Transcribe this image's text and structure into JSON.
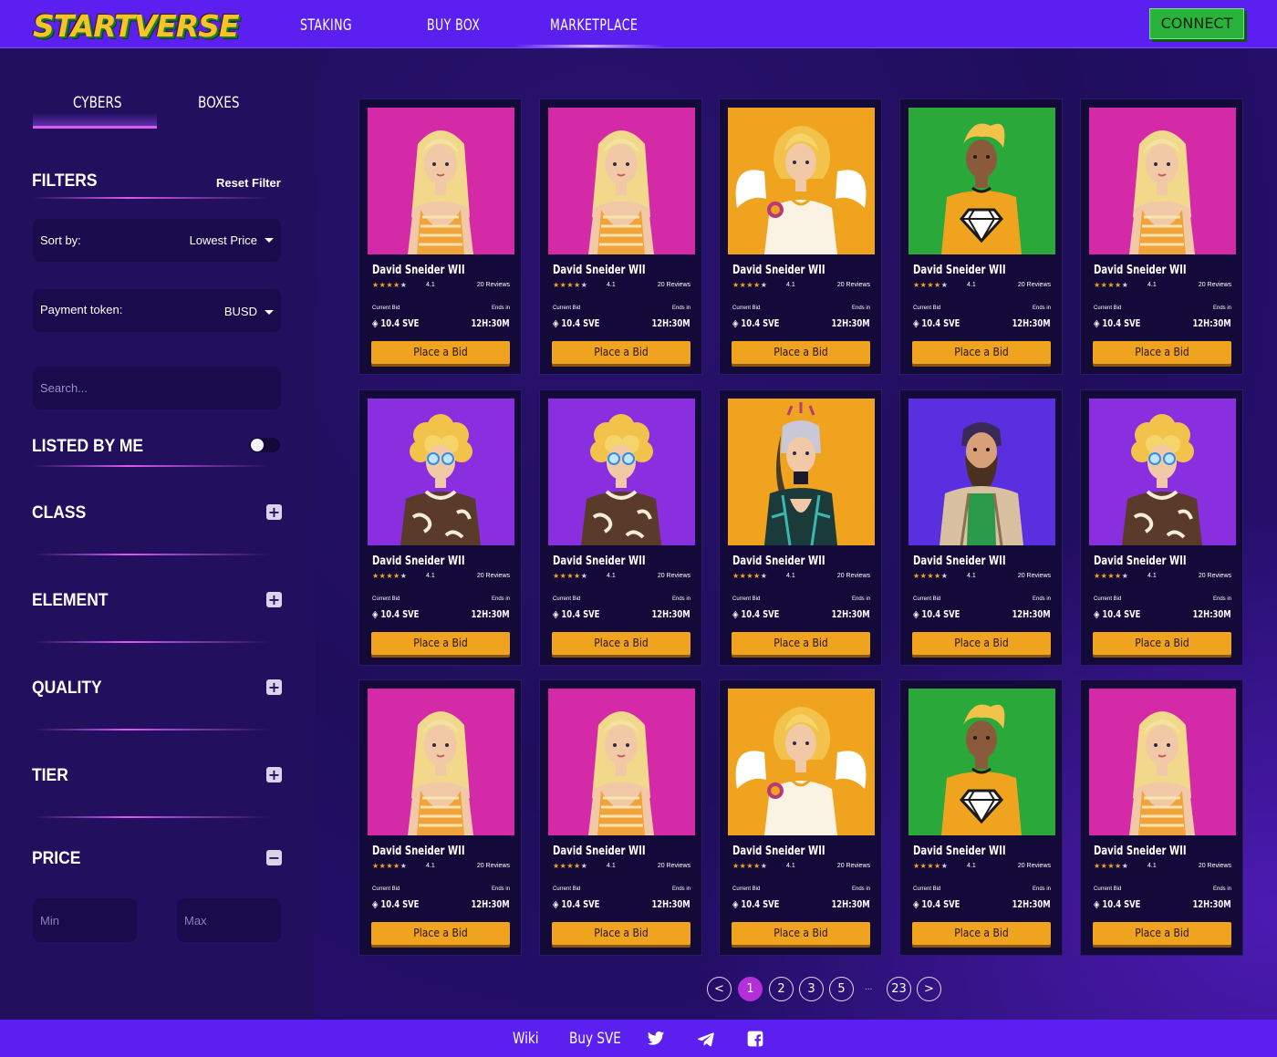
{
  "header": {
    "logo_main": "STARTVERSE",
    "nav": [
      "STAKING",
      "BUY BOX",
      "MARKETPLACE"
    ],
    "connect_label": "CONNECT"
  },
  "sidebar": {
    "tabs": [
      "CYBERS",
      "BOXES"
    ],
    "filters_title": "FILTERS",
    "reset_label": "Reset Filter",
    "sort": {
      "label": "Sort by:",
      "value": "Lowest Price"
    },
    "payment": {
      "label": "Payment token:",
      "value": "BUSD"
    },
    "search_placeholder": "Search...",
    "listed_by_me": "LISTED BY ME",
    "sections": [
      "CLASS",
      "ELEMENT",
      "QUALITY",
      "TIER",
      "PRICE"
    ],
    "price_min_placeholder": "Min",
    "price_max_placeholder": "Max"
  },
  "cards": [
    {
      "name": "David Sneider WII",
      "rating": "4.1",
      "reviews": "20 Reviews",
      "bid_label": "Current Bid",
      "price": "10.4 SVE",
      "ends_label": "Ends in",
      "time": "12H:30M",
      "button": "Place a Bid",
      "bg": "#d42aa8",
      "character": "blonde-girl"
    },
    {
      "name": "David Sneider WII",
      "rating": "4.1",
      "reviews": "20 Reviews",
      "bid_label": "Current Bid",
      "price": "10.4 SVE",
      "ends_label": "Ends in",
      "time": "12H:30M",
      "button": "Place a Bid",
      "bg": "#d42aa8",
      "character": "blonde-girl"
    },
    {
      "name": "David Sneider WII",
      "rating": "4.1",
      "reviews": "20 Reviews",
      "bid_label": "Current Bid",
      "price": "10.4 SVE",
      "ends_label": "Ends in",
      "time": "12H:30M",
      "button": "Place a Bid",
      "bg": "#f0a31f",
      "character": "angel"
    },
    {
      "name": "David Sneider WII",
      "rating": "4.1",
      "reviews": "20 Reviews",
      "bid_label": "Current Bid",
      "price": "10.4 SVE",
      "ends_label": "Ends in",
      "time": "12H:30M",
      "button": "Place a Bid",
      "bg": "#2aa83a",
      "character": "diamond-guy"
    },
    {
      "name": "David Sneider WII",
      "rating": "4.1",
      "reviews": "20 Reviews",
      "bid_label": "Current Bid",
      "price": "10.4 SVE",
      "ends_label": "Ends in",
      "time": "12H:30M",
      "button": "Place a Bid",
      "bg": "#d42aa8",
      "character": "blonde-girl"
    },
    {
      "name": "David Sneider WII",
      "rating": "4.1",
      "reviews": "20 Reviews",
      "bid_label": "Current Bid",
      "price": "10.4 SVE",
      "ends_label": "Ends in",
      "time": "12H:30M",
      "button": "Place a Bid",
      "bg": "#8a2fe0",
      "character": "curly-girl"
    },
    {
      "name": "David Sneider WII",
      "rating": "4.1",
      "reviews": "20 Reviews",
      "bid_label": "Current Bid",
      "price": "10.4 SVE",
      "ends_label": "Ends in",
      "time": "12H:30M",
      "button": "Place a Bid",
      "bg": "#8a2fe0",
      "character": "curly-girl"
    },
    {
      "name": "David Sneider WII",
      "rating": "4.1",
      "reviews": "20 Reviews",
      "bid_label": "Current Bid",
      "price": "10.4 SVE",
      "ends_label": "Ends in",
      "time": "12H:30M",
      "button": "Place a Bid",
      "bg": "#f0a31f",
      "character": "cyber-girl"
    },
    {
      "name": "David Sneider WII",
      "rating": "4.1",
      "reviews": "20 Reviews",
      "bid_label": "Current Bid",
      "price": "10.4 SVE",
      "ends_label": "Ends in",
      "time": "12H:30M",
      "button": "Place a Bid",
      "bg": "#5a2fe0",
      "character": "bearded-man"
    },
    {
      "name": "David Sneider WII",
      "rating": "4.1",
      "reviews": "20 Reviews",
      "bid_label": "Current Bid",
      "price": "10.4 SVE",
      "ends_label": "Ends in",
      "time": "12H:30M",
      "button": "Place a Bid",
      "bg": "#8a2fe0",
      "character": "curly-girl"
    },
    {
      "name": "David Sneider WII",
      "rating": "4.1",
      "reviews": "20 Reviews",
      "bid_label": "Current Bid",
      "price": "10.4 SVE",
      "ends_label": "Ends in",
      "time": "12H:30M",
      "button": "Place a Bid",
      "bg": "#d42aa8",
      "character": "blonde-girl"
    },
    {
      "name": "David Sneider WII",
      "rating": "4.1",
      "reviews": "20 Reviews",
      "bid_label": "Current Bid",
      "price": "10.4 SVE",
      "ends_label": "Ends in",
      "time": "12H:30M",
      "button": "Place a Bid",
      "bg": "#d42aa8",
      "character": "blonde-girl"
    },
    {
      "name": "David Sneider WII",
      "rating": "4.1",
      "reviews": "20 Reviews",
      "bid_label": "Current Bid",
      "price": "10.4 SVE",
      "ends_label": "Ends in",
      "time": "12H:30M",
      "button": "Place a Bid",
      "bg": "#f0a31f",
      "character": "angel"
    },
    {
      "name": "David Sneider WII",
      "rating": "4.1",
      "reviews": "20 Reviews",
      "bid_label": "Current Bid",
      "price": "10.4 SVE",
      "ends_label": "Ends in",
      "time": "12H:30M",
      "button": "Place a Bid",
      "bg": "#2aa83a",
      "character": "diamond-guy"
    },
    {
      "name": "David Sneider WII",
      "rating": "4.1",
      "reviews": "20 Reviews",
      "bid_label": "Current Bid",
      "price": "10.4 SVE",
      "ends_label": "Ends in",
      "time": "12H:30M",
      "button": "Place a Bid",
      "bg": "#d42aa8",
      "character": "blonde-girl"
    }
  ],
  "pagination": {
    "prev": "<",
    "pages": [
      "1",
      "2",
      "3",
      "5"
    ],
    "ellipsis": "...",
    "last": "23",
    "next": ">",
    "current": "1"
  },
  "footer": {
    "links": [
      "Wiki",
      "Buy SVE"
    ],
    "icons": [
      "twitter-icon",
      "telegram-icon",
      "facebook-icon"
    ]
  }
}
